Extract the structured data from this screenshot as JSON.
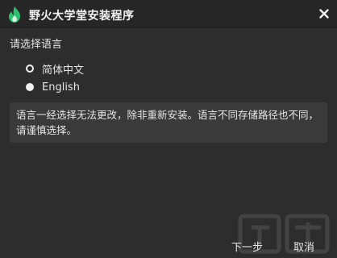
{
  "window": {
    "title": "野火大学堂安装程序"
  },
  "language": {
    "section_label": "请选择语言",
    "options": [
      {
        "label": "简体中文",
        "selected": true
      },
      {
        "label": "English",
        "selected": false
      }
    ]
  },
  "notice": {
    "text": "语言一经选择无法更改，除非重新安装。语言不同存储路径也不同，请谨慎选择。"
  },
  "footer": {
    "next_label": "下一步",
    "cancel_label": "取消"
  },
  "colors": {
    "background": "#2d2d2d",
    "titlebar": "#262626",
    "notice_bg": "#3a3a3a",
    "logo_green": "#2fbf71"
  },
  "icons": {
    "logo": "flame-logo-icon",
    "close": "close-icon"
  }
}
